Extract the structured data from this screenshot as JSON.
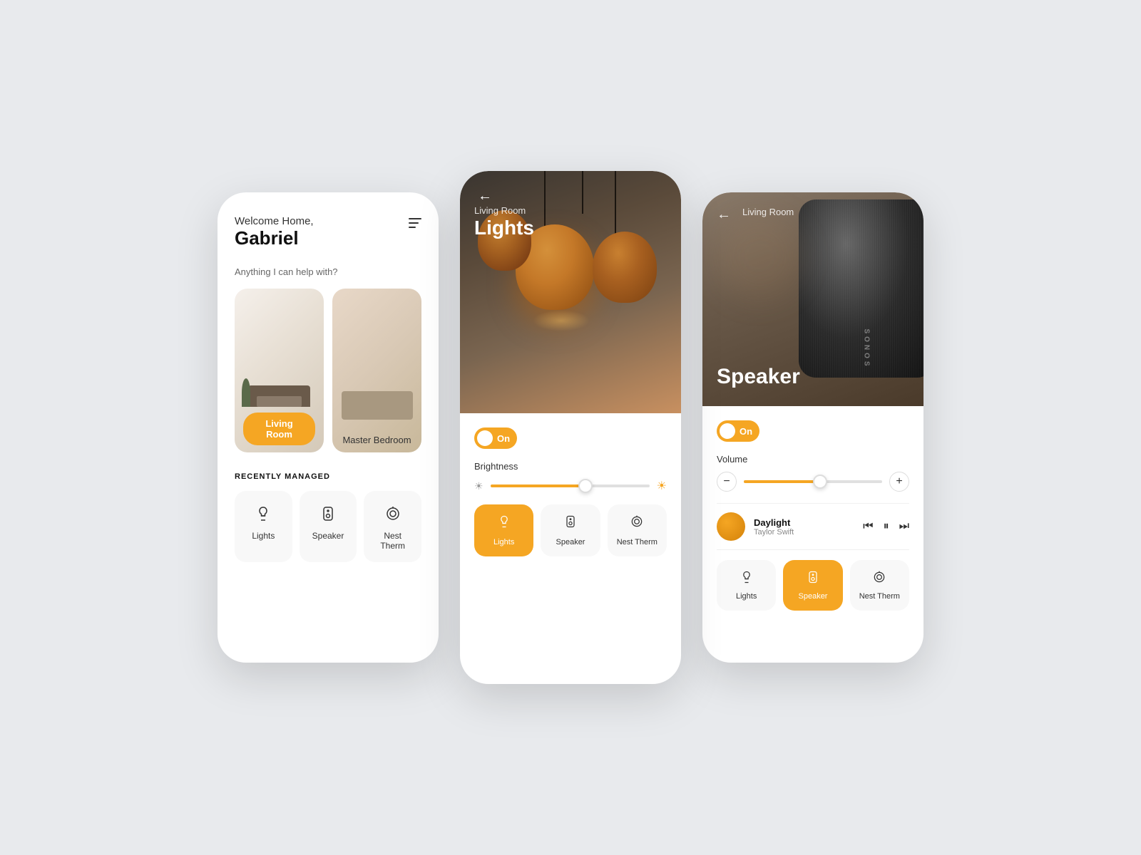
{
  "background": "#e8eaed",
  "accent": "#F5A623",
  "phone1": {
    "welcome": "Welcome Home,",
    "name": "Gabriel",
    "subtitle": "Anything I can help with?",
    "rooms": [
      {
        "label": "Living Room",
        "type": "living",
        "hasBadge": true
      },
      {
        "label": "Master Bedroom",
        "type": "master",
        "hasBadge": false
      }
    ],
    "recently_managed_title": "RECENTLY MANAGED",
    "devices": [
      {
        "name": "Lights",
        "icon": "lamp-icon"
      },
      {
        "name": "Speaker",
        "icon": "speaker-icon"
      },
      {
        "name": "Nest Therm",
        "icon": "nest-icon"
      }
    ]
  },
  "phone2": {
    "back_label": "←",
    "room": "Living Room",
    "device": "Lights",
    "toggle_label": "On",
    "toggle_on": true,
    "brightness_label": "Brightness",
    "brightness_value": 65,
    "tabs": [
      {
        "name": "Lights",
        "icon": "lamp-icon",
        "active": true
      },
      {
        "name": "Speaker",
        "icon": "speaker-icon",
        "active": false
      },
      {
        "name": "Nest Therm",
        "icon": "nest-icon",
        "active": false
      }
    ]
  },
  "phone3": {
    "back_label": "←",
    "room": "Living Room",
    "device": "Speaker",
    "toggle_label": "On",
    "toggle_on": true,
    "volume_label": "Volume",
    "volume_value": 60,
    "track_name": "Daylight",
    "track_artist": "Taylor Swift",
    "tabs": [
      {
        "name": "Lights",
        "icon": "lamp-icon",
        "active": false
      },
      {
        "name": "Speaker",
        "icon": "speaker-icon",
        "active": true
      },
      {
        "name": "Nest Therm",
        "icon": "nest-icon",
        "active": false
      }
    ]
  }
}
